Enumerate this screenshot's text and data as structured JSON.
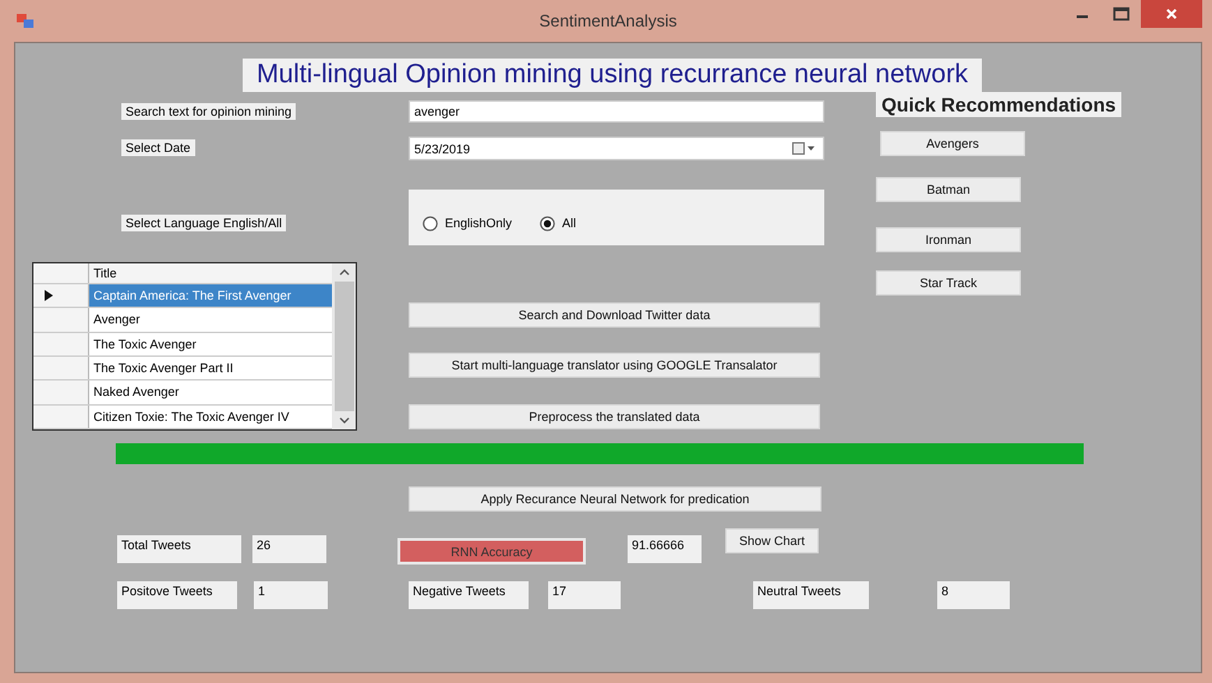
{
  "window": {
    "title": "SentimentAnalysis"
  },
  "heading": "Multi-lingual Opinion mining using recurrance neural network",
  "search": {
    "label": "Search text for opinion mining",
    "value": "avenger"
  },
  "date": {
    "label": "Select Date",
    "value": "5/23/2019"
  },
  "language": {
    "label": "Select Language English/All",
    "options": [
      {
        "label": "EnglishOnly",
        "selected": false
      },
      {
        "label": "All",
        "selected": true
      }
    ]
  },
  "table": {
    "columns": [
      "Title"
    ],
    "rows": [
      {
        "title": "Captain America: The First Avenger",
        "selected": true
      },
      {
        "title": "Avenger",
        "selected": false
      },
      {
        "title": "The Toxic Avenger",
        "selected": false
      },
      {
        "title": "The Toxic Avenger Part II",
        "selected": false
      },
      {
        "title": "Naked Avenger",
        "selected": false
      },
      {
        "title": "Citizen Toxie: The Toxic Avenger IV",
        "selected": false
      }
    ]
  },
  "actions": [
    "Search and Download Twitter data",
    "Start multi-language translator using GOOGLE Transalator",
    "Preprocess the translated data"
  ],
  "recommendations": {
    "title": "Quick Recommendations",
    "buttons": [
      "Avengers",
      "Batman",
      "Ironman",
      "Star Track"
    ]
  },
  "progress": {
    "level": 1
  },
  "apply_button": "Apply Recurance Neural Network for predication",
  "stats": {
    "total_tweets": {
      "label": "Total Tweets",
      "value": "26"
    },
    "rnn_accuracy": {
      "label": "RNN Accuracy",
      "value": "91.66666",
      "highlighted": true
    },
    "show_chart": "Show Chart",
    "positive_tweets": {
      "label": "Positove Tweets",
      "value": "1"
    },
    "negative_tweets": {
      "label": "Negative Tweets",
      "value": "17"
    },
    "neutral_tweets": {
      "label": "Neutral Tweets",
      "value": "8"
    }
  }
}
